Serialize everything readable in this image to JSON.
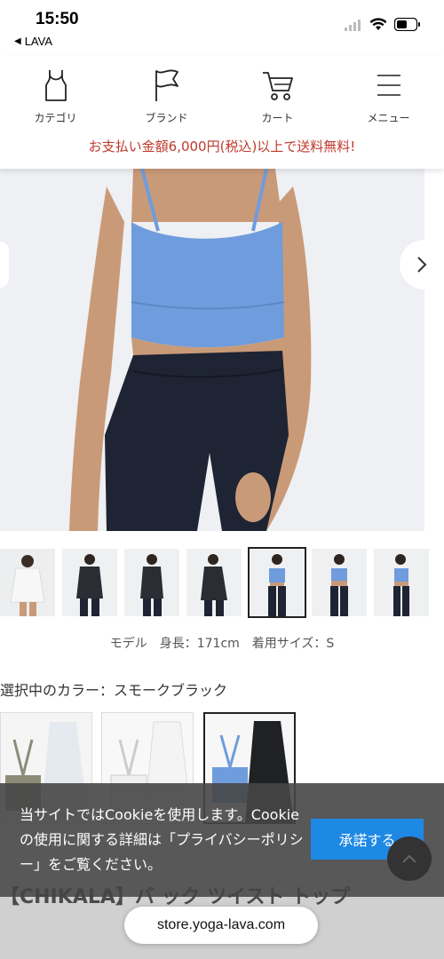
{
  "status_bar": {
    "time": "15:50",
    "back_app": "LAVA"
  },
  "nav": {
    "items": [
      {
        "label": "カテゴリ",
        "icon": "tank-top-icon"
      },
      {
        "label": "ブランド",
        "icon": "flag-icon"
      },
      {
        "label": "カート",
        "icon": "cart-icon"
      },
      {
        "label": "メニュー",
        "icon": "menu-icon"
      }
    ]
  },
  "shipping_banner": "お支払い金額6,000円(税込)以上で送料無料!",
  "model_info": "モデル　身長：171cm　着用サイズ：S",
  "color_selection": {
    "label": "選択中のカラー：スモークブラック"
  },
  "product_title": "【CHIKALA】バ ック ツイスト トップ",
  "cookie": {
    "text": "当サイトではCookieを使用します。Cookieの使用に関する詳細は「プライバシーポリシー」をご覧ください。",
    "accept_label": "承諾する"
  },
  "browser": {
    "url": "store.yoga-lava.com"
  },
  "colors": {
    "accent_red": "#c0392b",
    "button_blue": "#1e88e5"
  }
}
